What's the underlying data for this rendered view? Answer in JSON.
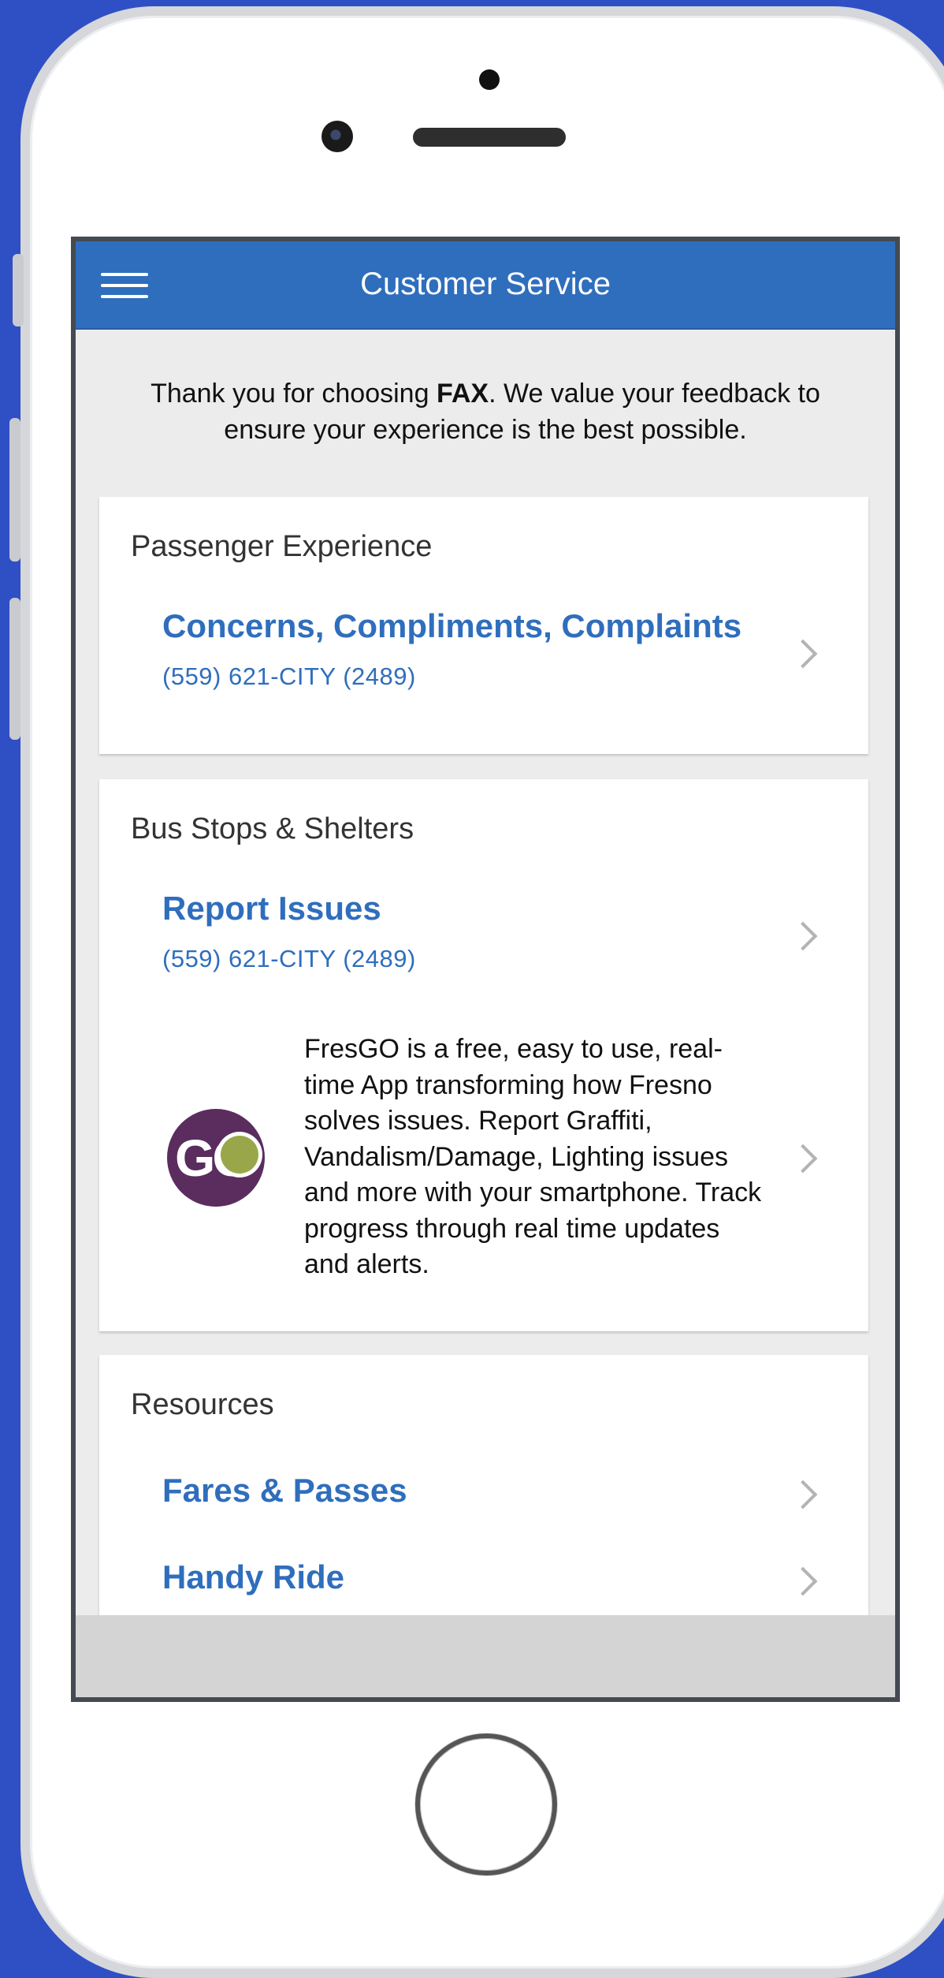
{
  "app": {
    "title": "Customer Service",
    "intro_before": "Thank you for choosing ",
    "intro_brand": "FAX",
    "intro_after": ". We value your feedback to ensure your experience is the best possible."
  },
  "sections": {
    "passenger": {
      "title": "Passenger Experience",
      "link_title": "Concerns, Compliments, Complaints",
      "link_phone": "(559) 621-CITY (2489)"
    },
    "bus_stops": {
      "title": "Bus Stops & Shelters",
      "link_title": "Report Issues",
      "link_phone": "(559) 621-CITY (2489)",
      "fresgo_logo_text": "GO",
      "fresgo_description": "FresGO is a free, easy to use, real-time App transforming how Fresno solves issues. Report Graffiti, Vandalism/Damage, Lighting issues and more with your smartphone. Track progress through real time updates and alerts."
    },
    "resources": {
      "title": "Resources",
      "items": [
        "Fares & Passes",
        "Handy Ride"
      ]
    }
  },
  "colors": {
    "accent": "#2f6ebd",
    "background": "#2f4fc4",
    "logo_purple": "#5a2d5e",
    "logo_green": "#9aa64a"
  },
  "icons": {
    "menu": "hamburger-menu-icon",
    "chevron": "chevron-right-icon"
  }
}
